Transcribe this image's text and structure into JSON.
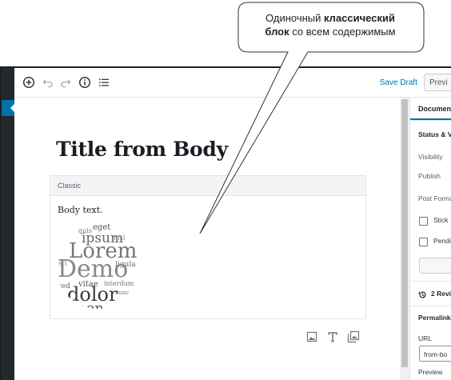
{
  "callout": {
    "line1_normal": "Одиночный ",
    "line1_bold": "классический",
    "line2_bold": "блок",
    "line2_normal": " со всем содержимым"
  },
  "toolbar": {
    "icons": [
      "add-block-icon",
      "undo-icon",
      "redo-icon",
      "info-icon",
      "outline-icon"
    ],
    "save_draft": "Save Draft",
    "preview": "Previ"
  },
  "editor": {
    "title": "Title from Body",
    "classic_block_label": "Classic",
    "body_text": "Body text.",
    "word_cloud_words": [
      "eget",
      "quis",
      "ipsum",
      "Lorem",
      "Demo",
      "sit",
      "nisl",
      "vitae",
      "sed",
      "dolor",
      "non",
      "ligula",
      "interdum",
      "nunc"
    ],
    "inserter_icons": [
      "image-icon",
      "text-icon",
      "gallery-icon"
    ]
  },
  "sidebar": {
    "tab": "Document",
    "status_heading": "Status & V",
    "visibility": "Visibility",
    "publish": "Publish",
    "post_format": "Post Forma",
    "stick": "Stick",
    "pending": "Pendi",
    "revisions": "2 Revi",
    "permalink": "Permalink",
    "url_label": "URL",
    "url_value": "from-bo",
    "preview_label": "Preview"
  },
  "colors": {
    "accent": "#0073aa",
    "admin_bar": "#23282d",
    "title": "#191e23"
  }
}
